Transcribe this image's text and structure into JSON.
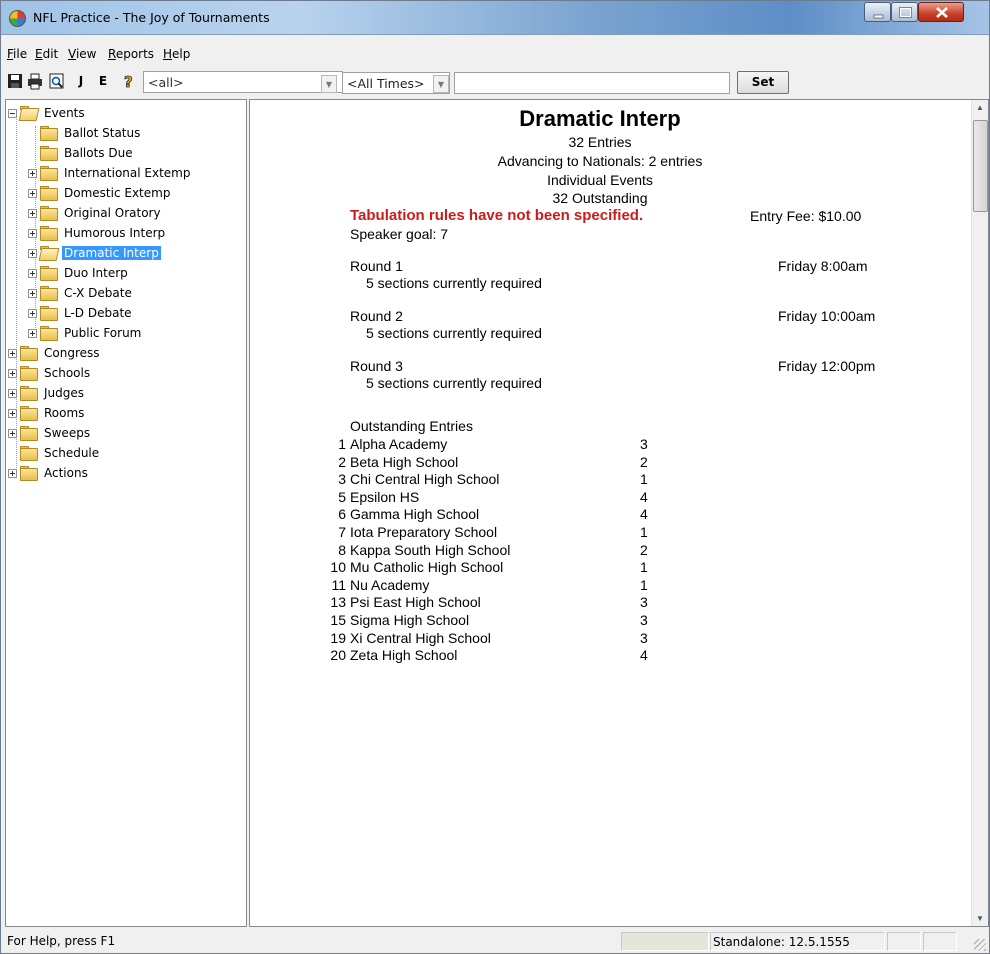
{
  "window": {
    "title": "NFL Practice - The Joy of Tournaments"
  },
  "menu": [
    "File",
    "Edit",
    "View",
    "Reports",
    "Help"
  ],
  "toolbar": {
    "j_label": "J",
    "e_label": "E",
    "filter_all": "<all>",
    "time_filter": "<All Times>",
    "search_value": "",
    "set_label": "Set"
  },
  "tree": {
    "events": "Events",
    "event_items": [
      "Ballot Status",
      "Ballots Due",
      "International Extemp",
      "Domestic Extemp",
      "Original Oratory",
      "Humorous Interp",
      "Dramatic Interp",
      "Duo Interp",
      "C-X Debate",
      "L-D Debate",
      "Public Forum"
    ],
    "top_items": [
      "Congress",
      "Schools",
      "Judges",
      "Rooms",
      "Sweeps",
      "Schedule",
      "Actions"
    ]
  },
  "doc": {
    "title": "Dramatic Interp",
    "entries": "32 Entries",
    "advancing": "Advancing to Nationals: 2 entries",
    "type": "Individual Events",
    "outstanding_count": "32 Outstanding",
    "warning": "Tabulation rules have not been specified.",
    "entry_fee": "Entry Fee: $10.00",
    "speaker_goal": "Speaker goal: 7",
    "rounds": [
      {
        "name": "Round 1",
        "detail": "5 sections currently required",
        "time": "Friday  8:00am"
      },
      {
        "name": "Round 2",
        "detail": "5 sections currently required",
        "time": "Friday 10:00am"
      },
      {
        "name": "Round 3",
        "detail": "5 sections currently required",
        "time": "Friday 12:00pm"
      }
    ],
    "outstanding_header": "Outstanding Entries",
    "outstanding": [
      {
        "num": "1",
        "school": "Alpha Academy",
        "count": "3"
      },
      {
        "num": "2",
        "school": "Beta High School",
        "count": "2"
      },
      {
        "num": "3",
        "school": "Chi Central High School",
        "count": "1"
      },
      {
        "num": "5",
        "school": "Epsilon HS",
        "count": "4"
      },
      {
        "num": "6",
        "school": "Gamma High School",
        "count": "4"
      },
      {
        "num": "7",
        "school": "Iota Preparatory School",
        "count": "1"
      },
      {
        "num": "8",
        "school": "Kappa South High School",
        "count": "2"
      },
      {
        "num": "10",
        "school": "Mu Catholic High School",
        "count": "1"
      },
      {
        "num": "11",
        "school": "Nu Academy",
        "count": "1"
      },
      {
        "num": "13",
        "school": "Psi East High School",
        "count": "3"
      },
      {
        "num": "15",
        "school": "Sigma High School",
        "count": "3"
      },
      {
        "num": "19",
        "school": "Xi Central High School",
        "count": "3"
      },
      {
        "num": "20",
        "school": "Zeta High School",
        "count": "4"
      }
    ]
  },
  "status": {
    "help": "For Help, press F1",
    "version": "Standalone: 12.5.1555"
  }
}
